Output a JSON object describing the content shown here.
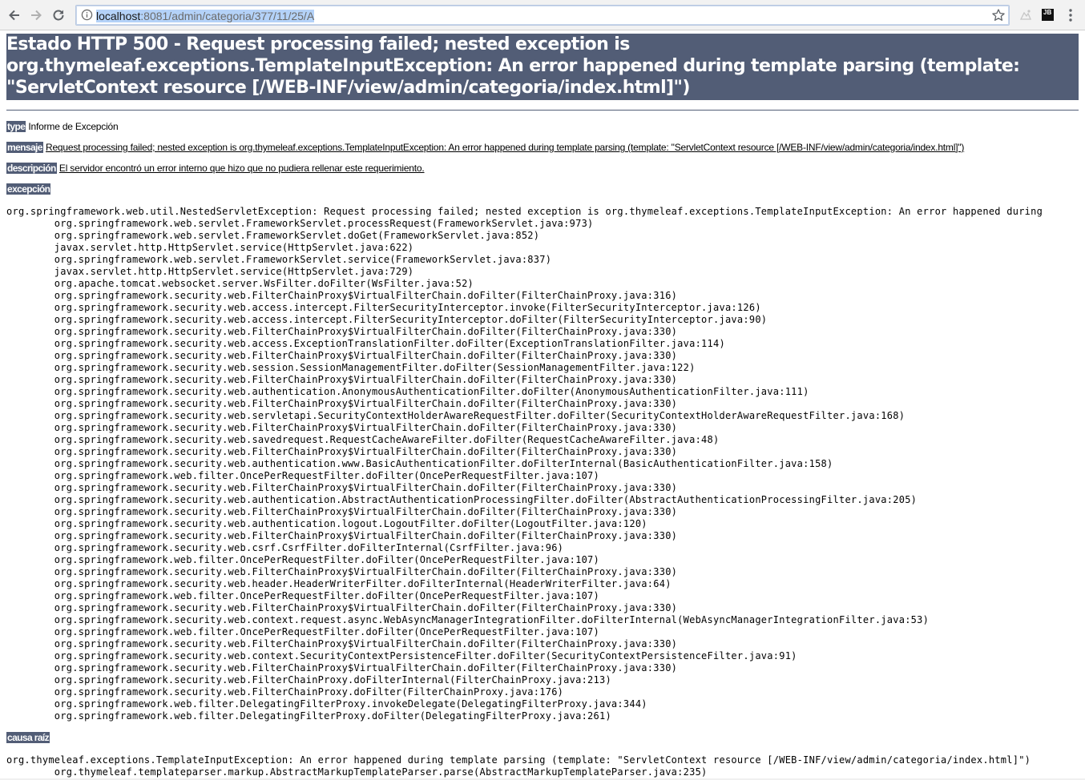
{
  "browser": {
    "url_host": "localhost",
    "url_rest": ":8081/admin/categoria/377/11/25/A",
    "icons": [
      "back-arrow-icon",
      "forward-arrow-icon",
      "reload-icon",
      "info-icon",
      "star-icon",
      "extension-icon",
      "jetbrains-icon",
      "menu-dots-icon"
    ],
    "jb_label": "JB"
  },
  "error": {
    "title": "Estado HTTP 500 - Request processing failed; nested exception is org.thymeleaf.exceptions.TemplateInputException: An error happened during template parsing (template: \"ServletContext resource [/WEB-INF/view/admin/categoria/index.html]\")",
    "type_label": "type",
    "type_value": "Informe de Excepción",
    "message_label": "mensaje",
    "message_value": "Request processing failed; nested exception is org.thymeleaf.exceptions.TemplateInputException: An error happened during template parsing (template: \"ServletContext resource [/WEB-INF/view/admin/categoria/index.html]\")",
    "description_label": "descripción",
    "description_value": "El servidor encontró un error interno que hizo que no pudiera rellenar este requerimiento.",
    "exception_label": "excepción",
    "exception_trace": "org.springframework.web.util.NestedServletException: Request processing failed; nested exception is org.thymeleaf.exceptions.TemplateInputException: An error happened during\n\torg.springframework.web.servlet.FrameworkServlet.processRequest(FrameworkServlet.java:973)\n\torg.springframework.web.servlet.FrameworkServlet.doGet(FrameworkServlet.java:852)\n\tjavax.servlet.http.HttpServlet.service(HttpServlet.java:622)\n\torg.springframework.web.servlet.FrameworkServlet.service(FrameworkServlet.java:837)\n\tjavax.servlet.http.HttpServlet.service(HttpServlet.java:729)\n\torg.apache.tomcat.websocket.server.WsFilter.doFilter(WsFilter.java:52)\n\torg.springframework.security.web.FilterChainProxy$VirtualFilterChain.doFilter(FilterChainProxy.java:316)\n\torg.springframework.security.web.access.intercept.FilterSecurityInterceptor.invoke(FilterSecurityInterceptor.java:126)\n\torg.springframework.security.web.access.intercept.FilterSecurityInterceptor.doFilter(FilterSecurityInterceptor.java:90)\n\torg.springframework.security.web.FilterChainProxy$VirtualFilterChain.doFilter(FilterChainProxy.java:330)\n\torg.springframework.security.web.access.ExceptionTranslationFilter.doFilter(ExceptionTranslationFilter.java:114)\n\torg.springframework.security.web.FilterChainProxy$VirtualFilterChain.doFilter(FilterChainProxy.java:330)\n\torg.springframework.security.web.session.SessionManagementFilter.doFilter(SessionManagementFilter.java:122)\n\torg.springframework.security.web.FilterChainProxy$VirtualFilterChain.doFilter(FilterChainProxy.java:330)\n\torg.springframework.security.web.authentication.AnonymousAuthenticationFilter.doFilter(AnonymousAuthenticationFilter.java:111)\n\torg.springframework.security.web.FilterChainProxy$VirtualFilterChain.doFilter(FilterChainProxy.java:330)\n\torg.springframework.security.web.servletapi.SecurityContextHolderAwareRequestFilter.doFilter(SecurityContextHolderAwareRequestFilter.java:168)\n\torg.springframework.security.web.FilterChainProxy$VirtualFilterChain.doFilter(FilterChainProxy.java:330)\n\torg.springframework.security.web.savedrequest.RequestCacheAwareFilter.doFilter(RequestCacheAwareFilter.java:48)\n\torg.springframework.security.web.FilterChainProxy$VirtualFilterChain.doFilter(FilterChainProxy.java:330)\n\torg.springframework.security.web.authentication.www.BasicAuthenticationFilter.doFilterInternal(BasicAuthenticationFilter.java:158)\n\torg.springframework.web.filter.OncePerRequestFilter.doFilter(OncePerRequestFilter.java:107)\n\torg.springframework.security.web.FilterChainProxy$VirtualFilterChain.doFilter(FilterChainProxy.java:330)\n\torg.springframework.security.web.authentication.AbstractAuthenticationProcessingFilter.doFilter(AbstractAuthenticationProcessingFilter.java:205)\n\torg.springframework.security.web.FilterChainProxy$VirtualFilterChain.doFilter(FilterChainProxy.java:330)\n\torg.springframework.security.web.authentication.logout.LogoutFilter.doFilter(LogoutFilter.java:120)\n\torg.springframework.security.web.FilterChainProxy$VirtualFilterChain.doFilter(FilterChainProxy.java:330)\n\torg.springframework.security.web.csrf.CsrfFilter.doFilterInternal(CsrfFilter.java:96)\n\torg.springframework.web.filter.OncePerRequestFilter.doFilter(OncePerRequestFilter.java:107)\n\torg.springframework.security.web.FilterChainProxy$VirtualFilterChain.doFilter(FilterChainProxy.java:330)\n\torg.springframework.security.web.header.HeaderWriterFilter.doFilterInternal(HeaderWriterFilter.java:64)\n\torg.springframework.web.filter.OncePerRequestFilter.doFilter(OncePerRequestFilter.java:107)\n\torg.springframework.security.web.FilterChainProxy$VirtualFilterChain.doFilter(FilterChainProxy.java:330)\n\torg.springframework.security.web.context.request.async.WebAsyncManagerIntegrationFilter.doFilterInternal(WebAsyncManagerIntegrationFilter.java:53)\n\torg.springframework.web.filter.OncePerRequestFilter.doFilter(OncePerRequestFilter.java:107)\n\torg.springframework.security.web.FilterChainProxy$VirtualFilterChain.doFilter(FilterChainProxy.java:330)\n\torg.springframework.security.web.context.SecurityContextPersistenceFilter.doFilter(SecurityContextPersistenceFilter.java:91)\n\torg.springframework.security.web.FilterChainProxy$VirtualFilterChain.doFilter(FilterChainProxy.java:330)\n\torg.springframework.security.web.FilterChainProxy.doFilterInternal(FilterChainProxy.java:213)\n\torg.springframework.security.web.FilterChainProxy.doFilter(FilterChainProxy.java:176)\n\torg.springframework.web.filter.DelegatingFilterProxy.invokeDelegate(DelegatingFilterProxy.java:344)\n\torg.springframework.web.filter.DelegatingFilterProxy.doFilter(DelegatingFilterProxy.java:261)",
    "root_cause_label": "causa raíz",
    "root_cause_trace": "org.thymeleaf.exceptions.TemplateInputException: An error happened during template parsing (template: \"ServletContext resource [/WEB-INF/view/admin/categoria/index.html]\")\n\torg.thymeleaf.templateparser.markup.AbstractMarkupTemplateParser.parse(AbstractMarkupTemplateParser.java:235)"
  },
  "colors": {
    "header_bg": "#525d76",
    "header_text": "#ffffff",
    "omnibox_selection": "#b4d2f8"
  }
}
